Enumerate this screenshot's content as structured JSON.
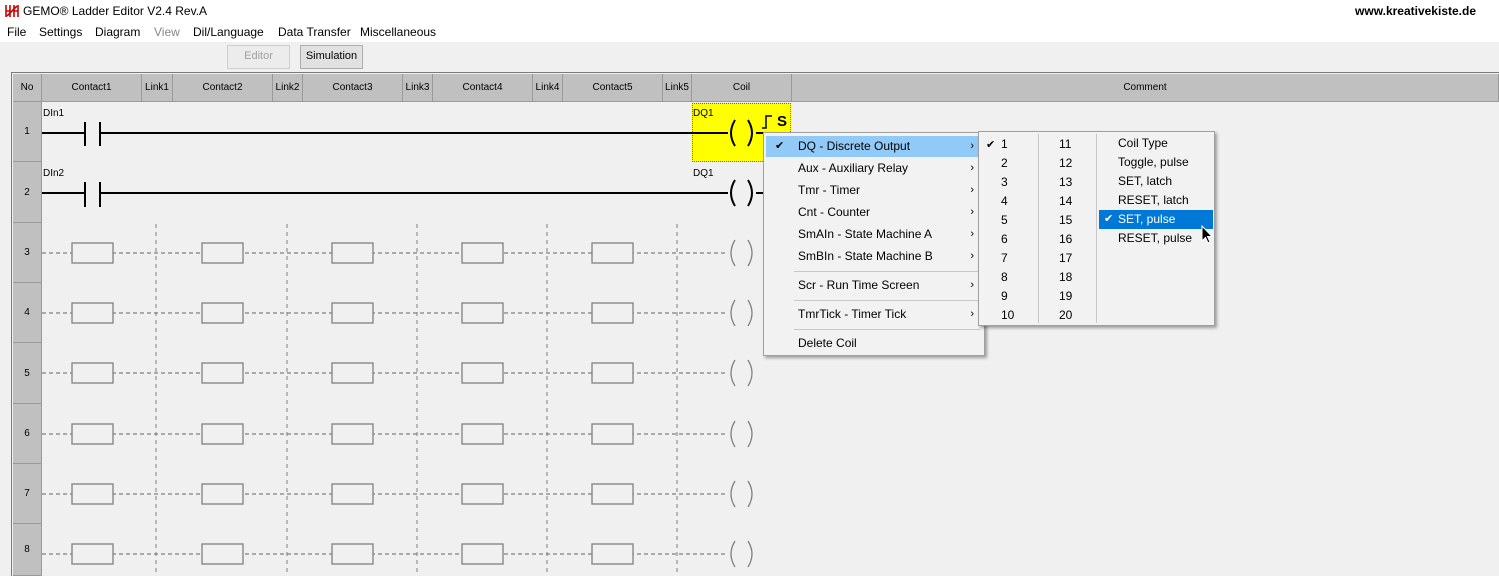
{
  "window": {
    "title": "GEMO® Ladder Editor V2.4 Rev.A",
    "website": "www.kreativekiste.de"
  },
  "menu": [
    {
      "label": "File",
      "enabled": true
    },
    {
      "label": "Settings",
      "enabled": true
    },
    {
      "label": "Diagram",
      "enabled": true
    },
    {
      "label": "View",
      "enabled": false
    },
    {
      "label": "Dil/Language",
      "enabled": true
    },
    {
      "label": "Data Transfer",
      "enabled": true
    },
    {
      "label": "Miscellaneous",
      "enabled": true
    }
  ],
  "toolbar": {
    "editor_label": "Editor",
    "simulation_label": "Simulation"
  },
  "columns": [
    "No",
    "Contact1",
    "Link1",
    "Contact2",
    "Link2",
    "Contact3",
    "Link3",
    "Contact4",
    "Link4",
    "Contact5",
    "Link5",
    "Coil",
    "Comment"
  ],
  "rows": [
    "1",
    "2",
    "3",
    "4",
    "5",
    "6",
    "7",
    "8"
  ],
  "rungs": {
    "row1": {
      "contact": "DIn1",
      "coil": "DQ1",
      "coil_mode": "S"
    },
    "row2": {
      "contact": "DIn2",
      "coil": "DQ1"
    }
  },
  "context_menu": {
    "items": [
      {
        "label": "DQ  - Discrete Output",
        "checked": true,
        "submenu": true
      },
      {
        "label": "Aux - Auxiliary Relay",
        "submenu": true
      },
      {
        "label": "Tmr - Timer",
        "submenu": true
      },
      {
        "label": "Cnt - Counter",
        "submenu": true
      },
      {
        "label": "SmAIn - State Machine A",
        "submenu": true
      },
      {
        "label": "SmBIn - State Machine B",
        "submenu": true
      },
      {
        "label": "Scr - Run Time Screen",
        "submenu": true
      },
      {
        "label": "TmrTick - Timer Tick",
        "submenu": true
      },
      {
        "label": "Delete Coil",
        "submenu": false
      }
    ]
  },
  "numbers_menu": {
    "col1": [
      "1",
      "2",
      "3",
      "4",
      "5",
      "6",
      "7",
      "8",
      "9",
      "10"
    ],
    "col2": [
      "11",
      "12",
      "13",
      "14",
      "15",
      "16",
      "17",
      "18",
      "19",
      "20"
    ],
    "checked": "1"
  },
  "coil_type_menu": {
    "items": [
      "Coil Type",
      "Toggle, pulse",
      "SET, latch",
      "RESET, latch",
      "SET, pulse",
      "RESET, pulse"
    ],
    "selected": "SET, pulse"
  },
  "colors": {
    "selected_coil_bg": "#ffff00",
    "menu_highlight": "#91c9f7",
    "selection_blue": "#0078d7"
  },
  "glyphs": {
    "check": "✔",
    "arrow": "›"
  }
}
